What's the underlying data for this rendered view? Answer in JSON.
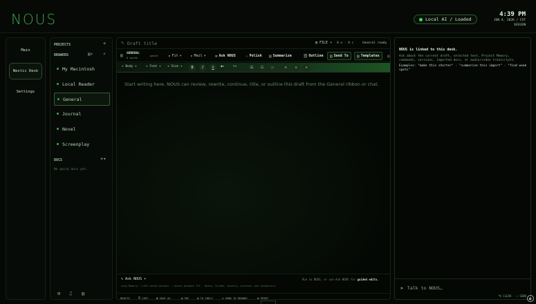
{
  "app": {
    "logo": "NOUS"
  },
  "status": {
    "label": "Local AI / Loaded"
  },
  "clock": {
    "time": "4:39 PM",
    "date": "JUN 4, 2026 / CST",
    "sub": "SESSION"
  },
  "rail": {
    "items": [
      "Main",
      "Nestic Desk",
      "Settings"
    ],
    "active": 1
  },
  "sidebar": {
    "projects_label": "PROJECTS",
    "drawers_label": "DRAWERS",
    "drawers": [
      "My Macintosh",
      "Local Reader",
      "General",
      "Journal",
      "Novel",
      "Screenplay"
    ],
    "active_drawer": 2,
    "docs_label": "DOCS",
    "docs_empty": "No quick docs yet."
  },
  "editor": {
    "draft_placeholder": "Draft title",
    "file_menu": "FILE",
    "counts": "0 w · 0 c",
    "status": "General ready",
    "tab": {
      "name": "GENERAL",
      "sub": "0 words",
      "paste": "paste"
    },
    "ribbon": [
      "Fit",
      "Mail",
      "Ask NOUS",
      "Polish",
      "Summarize",
      "Outline",
      "Send To",
      "Templates"
    ],
    "format": {
      "style": "Body",
      "font": "Font",
      "size": "Size"
    },
    "body_placeholder": "Start writing here. NOUS can review, rewrite, continue, title, or outline this draft from the General ribbon or chat.",
    "ask_label": "Ask NOUS",
    "ask_hint_pre": "Run to NOUS, or use Ask NOUS for",
    "ask_hint_bold": "guided edits.",
    "foot_info": "Long Memory: 1,024 saved context · recent prompts TTS · Notes, Slides, history, preview, and formatters.",
    "foot_items": [
      "DRAFTS",
      "COPY",
      "SAVE AS",
      "PDF",
      "TO SHELF",
      "SEND TO DRAWER",
      "PRINT"
    ]
  },
  "chat": {
    "linked": "NOUS is linked to this desk.",
    "desc": "Ask about the current draft, selected text, Project Memory, commands, versions, imported docs, or audio/video transcripts.",
    "examples": "Examples: \"make this shorter\" · \"summarize this import\" · \"find weak spots\"",
    "input_placeholder": "Talk to NOUS…",
    "footer": "^K CLEAR · ⏎ SEND"
  }
}
